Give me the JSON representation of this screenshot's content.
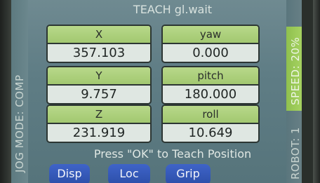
{
  "title": "TEACH gl.wait",
  "jog_mode": "JOG MODE: COMP",
  "speed": "SPEED: 20%",
  "robot": "ROBOT: 1",
  "fields": {
    "x": {
      "label": "X",
      "value": "357.103"
    },
    "y": {
      "label": "Y",
      "value": "9.757"
    },
    "z": {
      "label": "Z",
      "value": "231.919"
    },
    "yaw": {
      "label": "yaw",
      "value": "0.000"
    },
    "pitch": {
      "label": "pitch",
      "value": "180.000"
    },
    "roll": {
      "label": "roll",
      "value": "10.649"
    }
  },
  "hint": "Press \"OK\" to Teach Position",
  "buttons": {
    "disp": "Disp",
    "loc": "Loc",
    "grip": "Grip"
  },
  "colors": {
    "screen": "#5f7d85",
    "label_green": "#a8cc74",
    "speed_green": "#9bc958",
    "button_blue": "#2f52ad"
  }
}
